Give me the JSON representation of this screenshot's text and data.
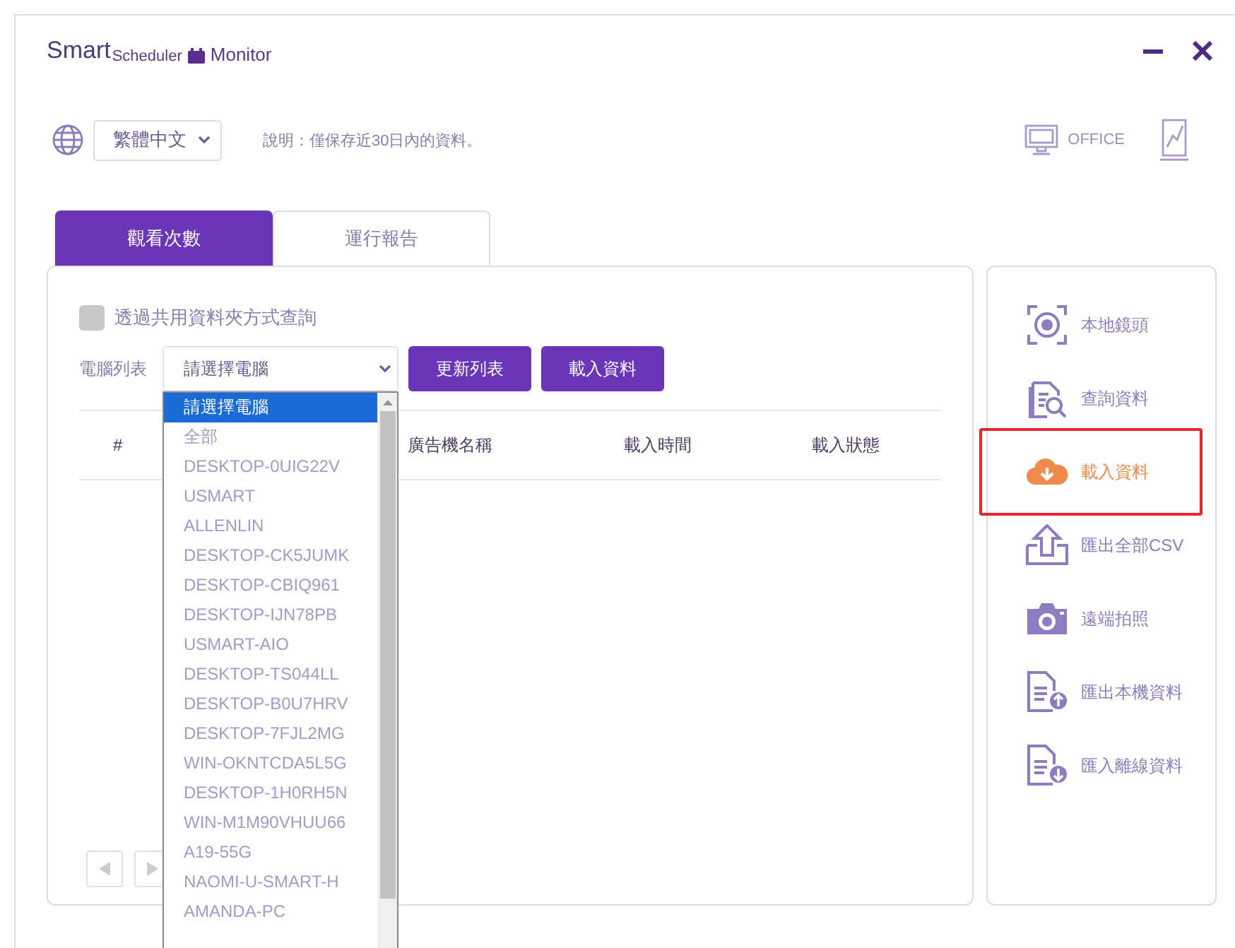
{
  "logo": {
    "part_1": "Smart",
    "part_2": "Scheduler",
    "part_3": "Monitor"
  },
  "window_controls": [
    {
      "kind": "minimize"
    },
    {
      "kind": "close"
    }
  ],
  "language_select": {
    "value": "繁體中文"
  },
  "note": "說明：僅保存近30日內的資料。",
  "mode": {
    "label": "OFFICE"
  },
  "tabs": [
    {
      "label": "觀看次數",
      "selected": true
    },
    {
      "label": "運行報告",
      "selected": false
    }
  ],
  "shared_folder": {
    "label": "透過共用資料夾方式查詢",
    "checked": false
  },
  "computer_list": {
    "label": "電腦列表",
    "value": "請選擇電腦"
  },
  "buttons": [
    "更新列表",
    "載入資料"
  ],
  "table": {
    "columns": [
      "#",
      "廣告機名稱",
      "載入時間",
      "載入狀態"
    ]
  },
  "dropdown": {
    "options": [
      {
        "label": "請選擇電腦",
        "selected": true
      },
      {
        "label": "全部",
        "selected": false
      },
      {
        "label": "DESKTOP-0UIG22V",
        "selected": false
      },
      {
        "label": "USMART",
        "selected": false
      },
      {
        "label": "ALLENLIN",
        "selected": false
      },
      {
        "label": "DESKTOP-CK5JUMK",
        "selected": false
      },
      {
        "label": "DESKTOP-CBIQ961",
        "selected": false
      },
      {
        "label": "DESKTOP-IJN78PB",
        "selected": false
      },
      {
        "label": "USMART-AIO",
        "selected": false
      },
      {
        "label": "DESKTOP-TS044LL",
        "selected": false
      },
      {
        "label": "DESKTOP-B0U7HRV",
        "selected": false
      },
      {
        "label": "DESKTOP-7FJL2MG",
        "selected": false
      },
      {
        "label": "WIN-OKNTCDA5L5G",
        "selected": false
      },
      {
        "label": "DESKTOP-1H0RH5N",
        "selected": false
      },
      {
        "label": "WIN-M1M90VHUU66",
        "selected": false
      },
      {
        "label": "A19-55G",
        "selected": false
      },
      {
        "label": "NAOMI-U-SMART-H",
        "selected": false
      },
      {
        "label": "AMANDA-PC",
        "selected": false
      }
    ]
  },
  "pagination": [
    {
      "kind": "prev"
    },
    {
      "kind": "next"
    }
  ],
  "sidebar": {
    "items": [
      {
        "kind": "camera-lens",
        "label": "本地鏡頭",
        "selected": false
      },
      {
        "kind": "search-doc",
        "label": "查詢資料",
        "selected": false
      },
      {
        "kind": "cloud-download",
        "label": "載入資料",
        "selected": true
      },
      {
        "kind": "upload",
        "label": "匯出全部CSV",
        "selected": false
      },
      {
        "kind": "camera",
        "label": "遠端拍照",
        "selected": false
      },
      {
        "kind": "doc-up",
        "label": "匯出本機資料",
        "selected": false
      },
      {
        "kind": "doc-down",
        "label": "匯入離線資料",
        "selected": false
      }
    ]
  }
}
